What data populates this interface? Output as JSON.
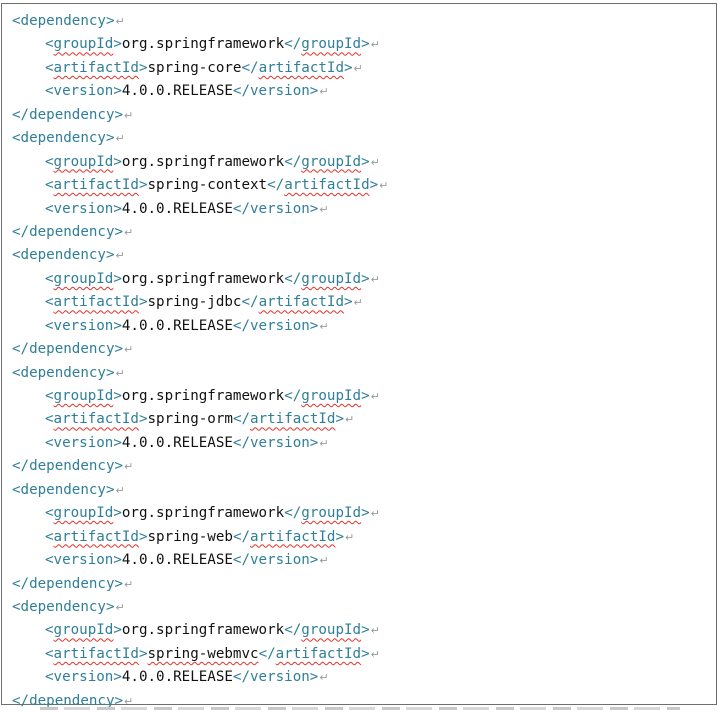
{
  "newline_mark": "↵",
  "dependencies": [
    {
      "open": "<dependency>",
      "close": "</dependency>",
      "group_open": "<",
      "group_tag": "groupId",
      "group_gt": ">",
      "group_value": "org.springframework",
      "group_close_lt": "</",
      "group_close_gt": ">",
      "artifact_open": "<",
      "artifact_tag": "artifactId",
      "artifact_gt": ">",
      "artifact_value": "spring-core",
      "artifact_close_lt": "</",
      "artifact_close_gt": ">",
      "version_open": "<version>",
      "version_value": "4.0.0.RELEASE",
      "version_close": "</version>"
    },
    {
      "open": "<dependency>",
      "close": "</dependency>",
      "group_open": "<",
      "group_tag": "groupId",
      "group_gt": ">",
      "group_value": "org.springframework",
      "group_close_lt": "</",
      "group_close_gt": ">",
      "artifact_open": "<",
      "artifact_tag": "artifactId",
      "artifact_gt": ">",
      "artifact_value": "spring-context",
      "artifact_close_lt": "</",
      "artifact_close_gt": ">",
      "version_open": "<version>",
      "version_value": "4.0.0.RELEASE",
      "version_close": "</version>"
    },
    {
      "open": "<dependency>",
      "close": "</dependency>",
      "group_open": "<",
      "group_tag": "groupId",
      "group_gt": ">",
      "group_value": "org.springframework",
      "group_close_lt": "</",
      "group_close_gt": ">",
      "artifact_open": "<",
      "artifact_tag": "artifactId",
      "artifact_gt": ">",
      "artifact_value": "spring-jdbc",
      "artifact_close_lt": "</",
      "artifact_close_gt": ">",
      "version_open": "<version>",
      "version_value": "4.0.0.RELEASE",
      "version_close": "</version>"
    },
    {
      "open": "<dependency>",
      "close": "</dependency>",
      "group_open": "<",
      "group_tag": "groupId",
      "group_gt": ">",
      "group_value": "org.springframework",
      "group_close_lt": "</",
      "group_close_gt": ">",
      "artifact_open": "<",
      "artifact_tag": "artifactId",
      "artifact_gt": ">",
      "artifact_value": "spring-orm",
      "artifact_close_lt": "</",
      "artifact_close_gt": ">",
      "version_open": "<version>",
      "version_value": "4.0.0.RELEASE",
      "version_close": "</version>"
    },
    {
      "open": "<dependency>",
      "close": "</dependency>",
      "group_open": "<",
      "group_tag": "groupId",
      "group_gt": ">",
      "group_value": "org.springframework",
      "group_close_lt": "</",
      "group_close_gt": ">",
      "artifact_open": "<",
      "artifact_tag": "artifactId",
      "artifact_gt": ">",
      "artifact_value": "spring-web",
      "artifact_close_lt": "</",
      "artifact_close_gt": ">",
      "version_open": "<version>",
      "version_value": "4.0.0.RELEASE",
      "version_close": "</version>"
    },
    {
      "open": "<dependency>",
      "close": "</dependency>",
      "group_open": "<",
      "group_tag": "groupId",
      "group_gt": ">",
      "group_value": "org.springframework",
      "group_close_lt": "</",
      "group_close_gt": ">",
      "artifact_open": "<",
      "artifact_tag": "artifactId",
      "artifact_gt": ">",
      "artifact_value": "spring-webmvc",
      "artifact_close_lt": "</",
      "artifact_close_gt": ">",
      "version_open": "<version>",
      "version_value": "4.0.0.RELEASE",
      "version_close": "</version>"
    }
  ]
}
